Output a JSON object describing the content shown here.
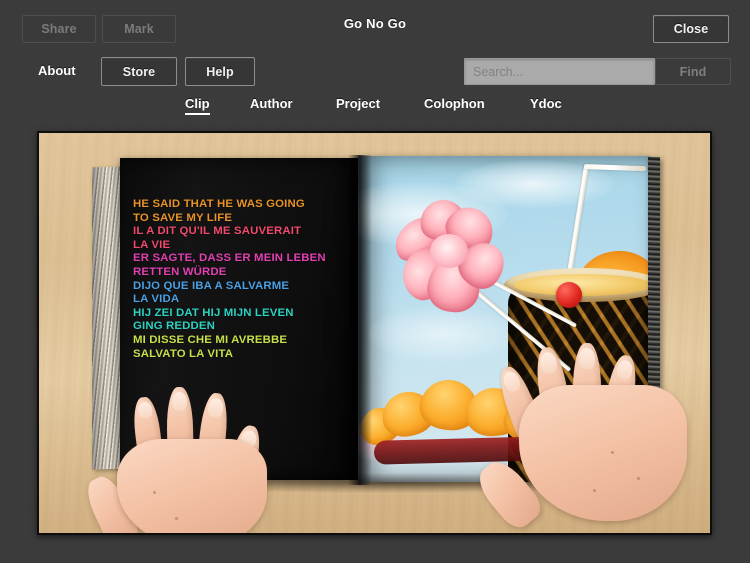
{
  "window": {
    "title": "Go No Go"
  },
  "toolbar": {
    "share_label": "Share",
    "mark_label": "Mark",
    "close_label": "Close",
    "about_label": "About",
    "store_label": "Store",
    "help_label": "Help",
    "find_label": "Find"
  },
  "search": {
    "placeholder": "Search...",
    "value": ""
  },
  "tabs": [
    {
      "label": "Clip",
      "active": true
    },
    {
      "label": "Author",
      "active": false
    },
    {
      "label": "Project",
      "active": false
    },
    {
      "label": "Colophon",
      "active": false
    },
    {
      "label": "Ydoc",
      "active": false
    }
  ],
  "media": {
    "alt": "Open photo book held by two hands on a light wood table. Left page is black with a multilingual phrase set in bold colored type; right page shows a tropical cocktail served in a carved pineapple with a pink flower, drinking straws, an orange slice and a cherry against a blue sky.",
    "left_page": {
      "lines": [
        {
          "text": "HE SAID THAT HE WAS GOING",
          "color": "#e8922a",
          "language": "English"
        },
        {
          "text": "TO SAVE MY LIFE",
          "color": "#e8922a",
          "language": "English"
        },
        {
          "text": "IL A DIT QU'IL ME SAUVERAIT",
          "color": "#f04a6e",
          "language": "French"
        },
        {
          "text": "LA VIE",
          "color": "#f04a6e",
          "language": "French"
        },
        {
          "text": "ER SAGTE, DASS ER MEIN LEBEN",
          "color": "#e241b4",
          "language": "German"
        },
        {
          "text": "RETTEN WÜRDE",
          "color": "#e241b4",
          "language": "German"
        },
        {
          "text": "DIJO QUE IBA A SALVARME",
          "color": "#4ba0e4",
          "language": "Spanish"
        },
        {
          "text": "LA VIDA",
          "color": "#4ba0e4",
          "language": "Spanish"
        },
        {
          "text": "HIJ ZEI DAT HIJ MIJN LEVEN",
          "color": "#2ed2c2",
          "language": "Dutch"
        },
        {
          "text": "GING REDDEN",
          "color": "#2ed2c2",
          "language": "Dutch"
        },
        {
          "text": "MI DISSE CHE MI AVREBBE",
          "color": "#c6e04a",
          "language": "Italian"
        },
        {
          "text": "SALVATO LA VITA",
          "color": "#c6e04a",
          "language": "Italian"
        }
      ]
    }
  },
  "colors": {
    "background": "#3a3a3a",
    "button_border": "#8d8d8d",
    "button_face": "#363636",
    "disabled_text": "#7b7b7b",
    "search_field": "#aaaaaa",
    "text": "#ffffff"
  }
}
